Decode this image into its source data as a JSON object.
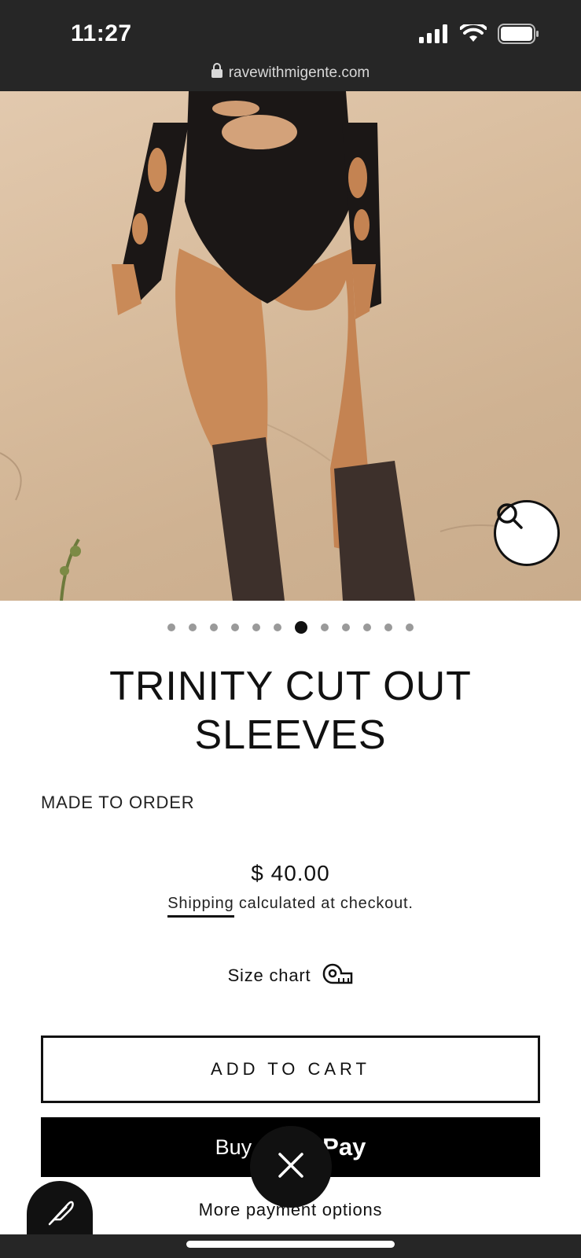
{
  "status_bar": {
    "time": "11:27",
    "icons": [
      "signal-icon",
      "wifi-icon",
      "battery-icon"
    ]
  },
  "browser": {
    "url": "ravewithmigente.com",
    "lock_icon": "lock-icon"
  },
  "gallery": {
    "image_count": 12,
    "active_index": 6,
    "zoom_icon": "search-icon"
  },
  "product": {
    "title": "TRINITY CUT OUT SLEEVES",
    "availability": "MADE TO ORDER",
    "price": "$ 40.00",
    "shipping_link": "Shipping",
    "shipping_text": " calculated at checkout.",
    "size_chart_label": "Size chart",
    "size_chart_icon": "tape-measure-icon"
  },
  "actions": {
    "add_to_cart": "ADD TO CART",
    "buy_left": "Buy",
    "buy_right": "Pay",
    "more_payment_options": "More payment options",
    "close_icon": "close-icon",
    "feather_icon": "feather-icon"
  },
  "colors": {
    "status_bar_bg": "#262626",
    "primary": "#111111",
    "background": "#ffffff",
    "dot_inactive": "#9a9a9a"
  }
}
